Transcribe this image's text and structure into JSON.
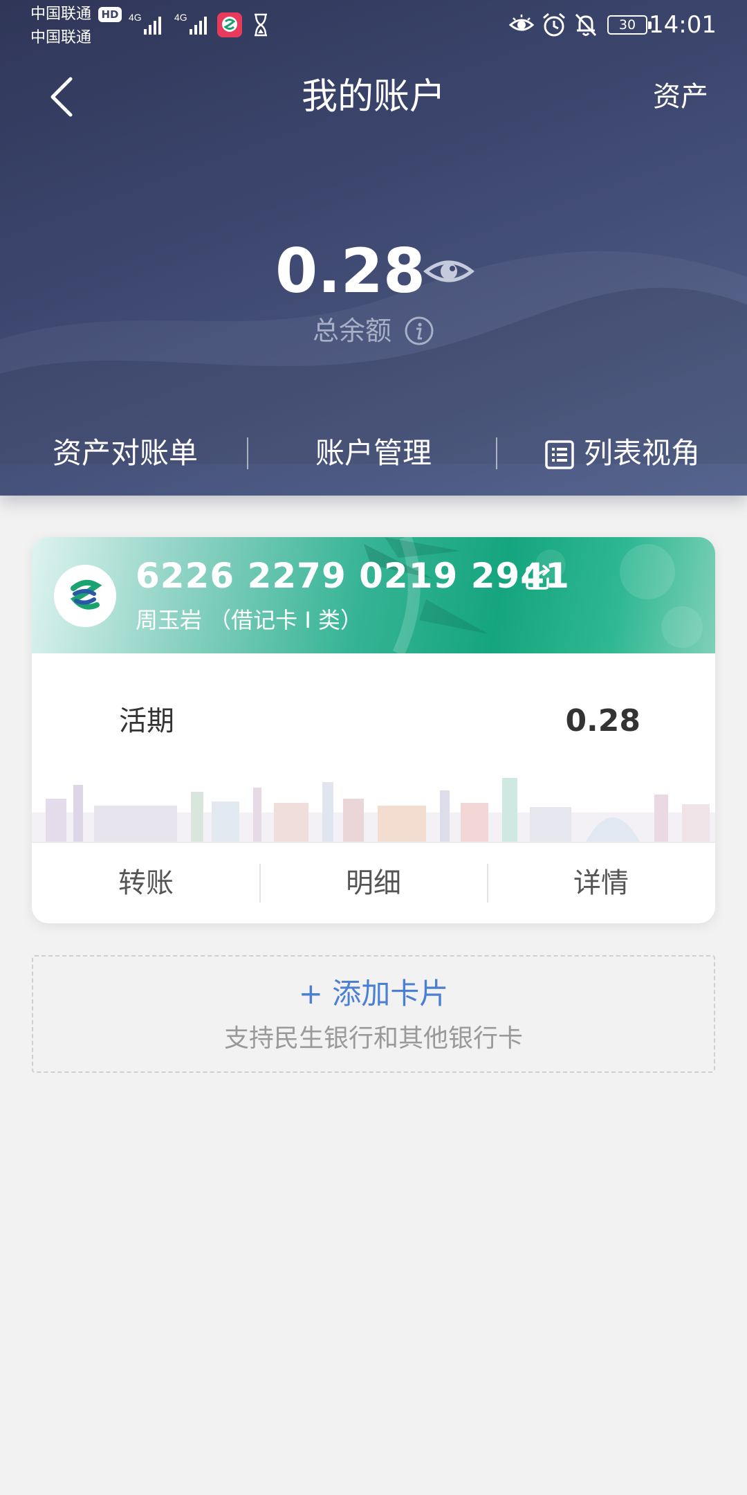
{
  "status_bar": {
    "carrier_1": "中国联通",
    "carrier_2": "中国联通",
    "hd_badge": "HD",
    "net_1": "4G",
    "net_2": "4G",
    "battery": "30",
    "time": "14:01"
  },
  "nav": {
    "title": "我的账户",
    "right_link": "资产"
  },
  "summary": {
    "balance": "0.28",
    "balance_label": "总余额"
  },
  "actions": {
    "statement": "资产对账单",
    "manage": "账户管理",
    "list_view": "列表视角"
  },
  "card": {
    "number": "6226 2279 0219 2941",
    "holder": "周玉岩 （借记卡 I 类）",
    "account_type": "活期",
    "amount": "0.28",
    "buttons": [
      "转账",
      "明细",
      "详情"
    ]
  },
  "add_card": {
    "title": "+ 添加卡片",
    "subtitle": "支持民生银行和其他银行卡"
  },
  "colors": {
    "header_bg": "#3e4870",
    "card_green": "#15a57e",
    "link_blue": "#4a7fd4"
  }
}
